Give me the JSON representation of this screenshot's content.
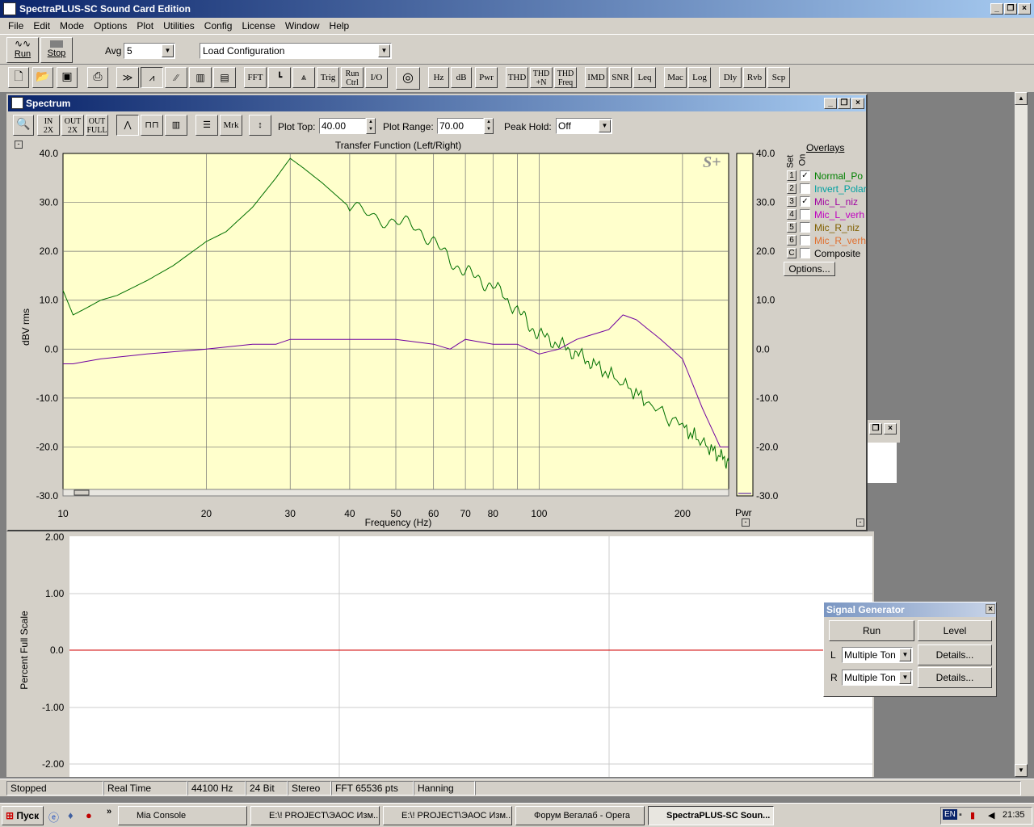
{
  "app": {
    "title": "SpectraPLUS-SC Sound Card Edition"
  },
  "menu": [
    "File",
    "Edit",
    "Mode",
    "Options",
    "Plot",
    "Utilities",
    "Config",
    "License",
    "Window",
    "Help"
  ],
  "toolbar1": {
    "run": "Run",
    "stop": "Stop",
    "avg_label": "Avg",
    "avg_value": "5",
    "config": "Load Configuration"
  },
  "toolbar2": {
    "buttons": [
      "FFT",
      "Trig",
      "Run Ctrl",
      "I/O",
      "Hz",
      "dB",
      "Pwr",
      "THD",
      "THD +N",
      "THD Freq",
      "IMD",
      "SNR",
      "Leq",
      "Mac",
      "Log",
      "Dly",
      "Rvb",
      "Scp"
    ]
  },
  "spectrum": {
    "title": "Spectrum",
    "zoom_buttons": [
      "2X",
      "2X",
      "FULL"
    ],
    "mrk": "Mrk",
    "plot_top_label": "Plot Top:",
    "plot_top": "40.00",
    "plot_range_label": "Plot Range:",
    "plot_range": "70.00",
    "peak_hold_label": "Peak Hold:",
    "peak_hold": "Off",
    "chart_title": "Transfer Function (Left/Right)",
    "ylabel": "dBV rms",
    "xlabel": "Frequency (Hz)",
    "pwr_label": "Pwr",
    "logo": "S+",
    "overlays_title": "Overlays",
    "set_label": "Set",
    "on_label": "On",
    "overlays": [
      {
        "num": "1",
        "name": "Normal_Po",
        "checked": true,
        "color": "#008000"
      },
      {
        "num": "2",
        "name": "Invert_Polar",
        "checked": false,
        "color": "#00a0a0"
      },
      {
        "num": "3",
        "name": "Mic_L_niz",
        "checked": true,
        "color": "#a000a0"
      },
      {
        "num": "4",
        "name": "Mic_L_verh",
        "checked": false,
        "color": "#c000c0"
      },
      {
        "num": "5",
        "name": "Mic_R_niz",
        "checked": false,
        "color": "#806000"
      },
      {
        "num": "6",
        "name": "Mic_R_verh",
        "checked": false,
        "color": "#e07030"
      },
      {
        "num": "C",
        "name": "Composite",
        "checked": false,
        "color": "#000000"
      }
    ],
    "options_btn": "Options..."
  },
  "chart_data": {
    "type": "line",
    "title": "Transfer Function (Left/Right)",
    "xlabel": "Frequency (Hz)",
    "ylabel": "dBV rms",
    "xscale": "log",
    "xlim": [
      10,
      250
    ],
    "ylim": [
      -30,
      40
    ],
    "xticks": [
      "10",
      "20",
      "30",
      "40",
      "50",
      "60",
      "70",
      "80",
      "100",
      "200"
    ],
    "yticks": [
      "40.0",
      "30.0",
      "20.0",
      "10.0",
      "0.0",
      "-10.0",
      "-20.0",
      "-30.0"
    ],
    "series": [
      {
        "name": "Normal_Po",
        "color": "#007000",
        "x": [
          10,
          10.5,
          11,
          12,
          13,
          15,
          17,
          20,
          22,
          25,
          28,
          30,
          32,
          35,
          40,
          45,
          50,
          55,
          60,
          65,
          70,
          75,
          80,
          90,
          95,
          100,
          110,
          120,
          130,
          150,
          170,
          200,
          220,
          240,
          250
        ],
        "y": [
          12,
          7,
          8,
          10,
          11,
          14,
          17,
          22,
          24,
          29,
          35,
          39,
          37,
          34,
          29,
          27,
          26,
          25,
          22,
          18,
          16,
          14,
          13,
          8,
          5,
          3,
          1,
          -1,
          -3,
          -7,
          -11,
          -16,
          -19,
          -22,
          -23
        ]
      },
      {
        "name": "Mic_L_niz",
        "color": "#7000a0",
        "x": [
          10,
          10.5,
          12,
          15,
          20,
          25,
          28,
          30,
          40,
          50,
          60,
          65,
          70,
          80,
          90,
          100,
          110,
          120,
          140,
          150,
          160,
          180,
          200,
          220,
          240,
          250
        ],
        "y": [
          -3,
          -3,
          -2,
          -1,
          0,
          1,
          1,
          2,
          2,
          2,
          1,
          0,
          2,
          1,
          1,
          -1,
          0,
          2,
          4,
          7,
          6,
          2,
          -2,
          -12,
          -20,
          -20
        ]
      }
    ],
    "grid": true
  },
  "lower_plot": {
    "ylabel": "Percent Full Scale",
    "yticks": [
      "2.00",
      "1.00",
      "0.0",
      "-1.00",
      "-2.00"
    ]
  },
  "signal_generator": {
    "title": "Signal Generator",
    "run": "Run",
    "level": "Level",
    "l_label": "L",
    "r_label": "R",
    "l_value": "Multiple Ton",
    "r_value": "Multiple Ton",
    "details": "Details..."
  },
  "status": [
    "Stopped",
    "Real Time",
    "44100 Hz",
    "24 Bit",
    "Stereo",
    "FFT 65536 pts",
    "Hanning"
  ],
  "taskbar": {
    "start": "Пуск",
    "tasks": [
      "Mia Console",
      "E:\\! PROJECT\\ЭАОС Изм...",
      "E:\\! PROJECT\\ЭАОС Изм...",
      "Форум Вегалаб - Opera",
      "SpectraPLUS-SC Soun..."
    ],
    "lang": "EN",
    "time": "21:35"
  }
}
